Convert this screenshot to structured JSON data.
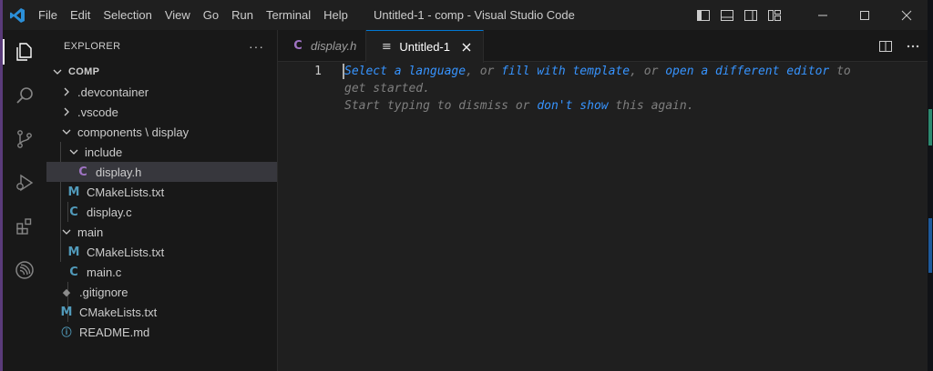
{
  "titlebar": {
    "menu": [
      "File",
      "Edit",
      "Selection",
      "View",
      "Go",
      "Run",
      "Terminal",
      "Help"
    ],
    "title": "Untitled-1 - comp - Visual Studio Code"
  },
  "activity": {
    "items": [
      "explorer",
      "search",
      "source-control",
      "run-debug",
      "extensions",
      "espressif"
    ]
  },
  "sidebar": {
    "title": "EXPLORER",
    "more": "···",
    "root": "COMP",
    "tree": [
      {
        "label": ".devcontainer",
        "type": "folder",
        "state": "collapsed"
      },
      {
        "label": ".vscode",
        "type": "folder",
        "state": "collapsed"
      },
      {
        "label": "components \\ display",
        "type": "folder",
        "state": "expanded"
      },
      {
        "label": "include",
        "type": "folder",
        "state": "expanded"
      },
      {
        "label": "display.h",
        "type": "c",
        "icon": "C",
        "selected": true
      },
      {
        "label": "CMakeLists.txt",
        "type": "cmake",
        "icon": "M"
      },
      {
        "label": "display.c",
        "type": "c-source",
        "icon": "C"
      },
      {
        "label": "main",
        "type": "folder",
        "state": "expanded"
      },
      {
        "label": "CMakeLists.txt",
        "type": "cmake",
        "icon": "M"
      },
      {
        "label": "main.c",
        "type": "c-source",
        "icon": "C"
      },
      {
        "label": ".gitignore",
        "type": "git",
        "icon": "◆"
      },
      {
        "label": "CMakeLists.txt",
        "type": "cmake",
        "icon": "M"
      },
      {
        "label": "README.md",
        "type": "info",
        "icon": "ⓘ"
      }
    ]
  },
  "editor": {
    "tabs": [
      {
        "label": "display.h",
        "icon": "C",
        "active": false
      },
      {
        "label": "Untitled-1",
        "icon": "≡",
        "active": true,
        "close": "✕"
      }
    ],
    "line_number": "1",
    "hint": {
      "link1": "Select a language",
      "sep1": ", or ",
      "link2": "fill with template",
      "sep2": ", or ",
      "link3": "open a different editor",
      "tail1": " to",
      "line2": "get started.",
      "line3a": "Start typing to dismiss or ",
      "link4": "don't show",
      "line3b": " this again."
    }
  },
  "colors": {
    "accent": "#0078d4",
    "link": "#3794ff",
    "c_icon": "#a074c4",
    "blue_icon": "#519aba"
  }
}
